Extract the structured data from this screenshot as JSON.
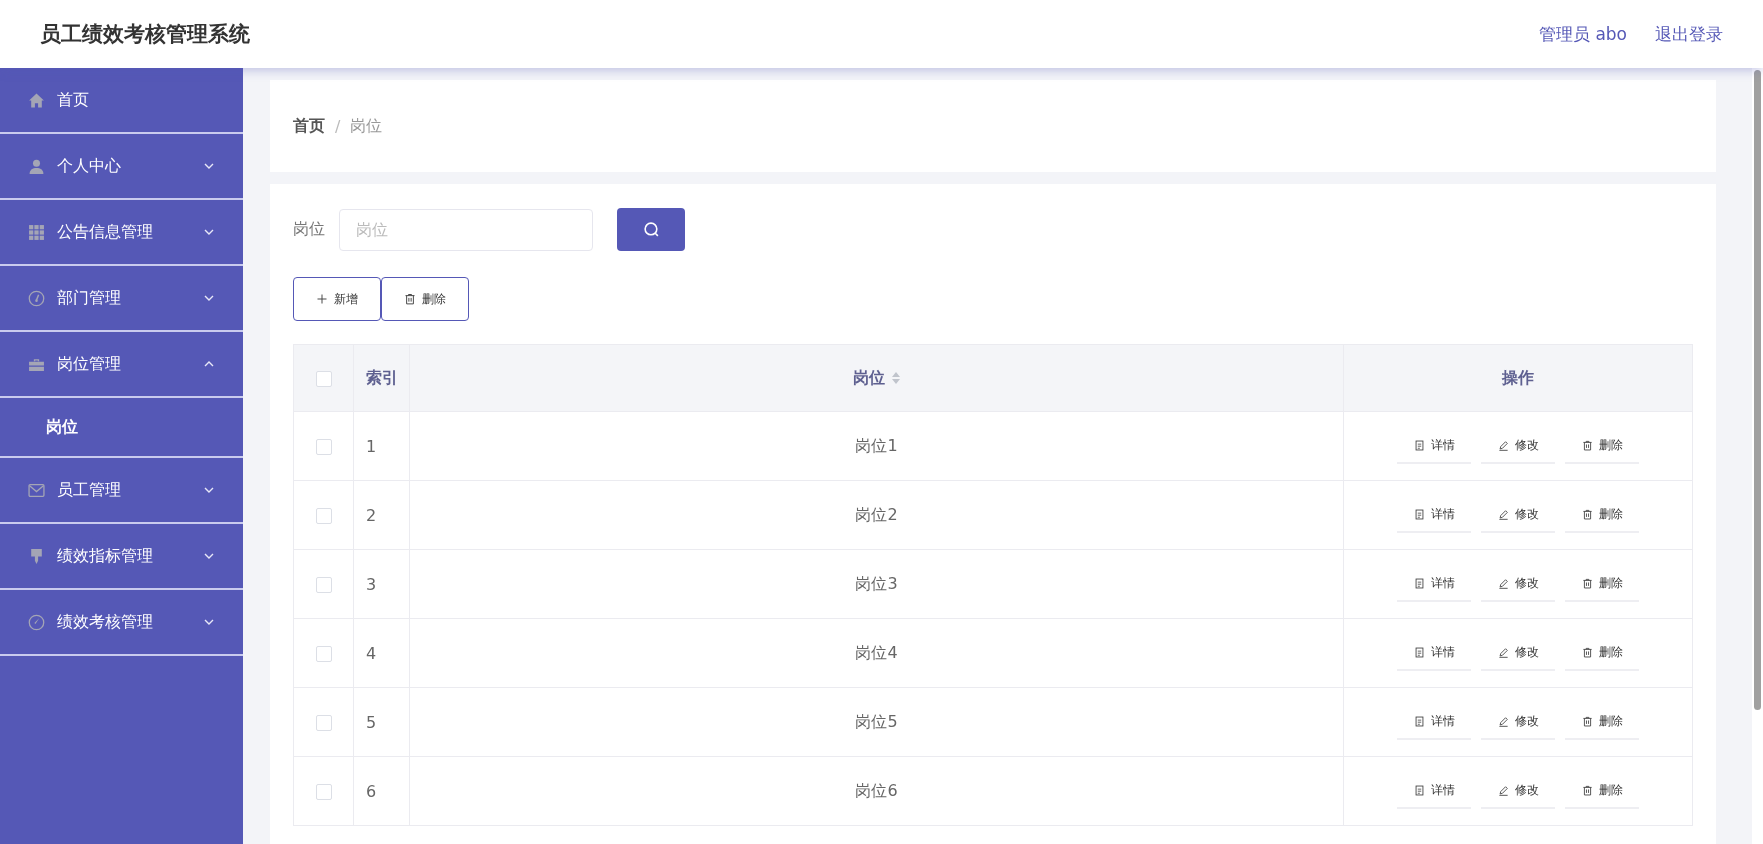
{
  "header": {
    "title": "员工绩效考核管理系统",
    "user": "管理员 abo",
    "logout": "退出登录"
  },
  "sidebar": {
    "items": [
      {
        "label": "首页",
        "kind": "link",
        "selected": false
      },
      {
        "label": "个人中心",
        "kind": "menu",
        "expanded": false
      },
      {
        "label": "公告信息管理",
        "kind": "menu",
        "expanded": false
      },
      {
        "label": "部门管理",
        "kind": "menu",
        "expanded": false
      },
      {
        "label": "岗位管理",
        "kind": "menu",
        "expanded": true,
        "children": [
          {
            "label": "岗位",
            "selected": true
          }
        ]
      },
      {
        "label": "员工管理",
        "kind": "menu",
        "expanded": false
      },
      {
        "label": "绩效指标管理",
        "kind": "menu",
        "expanded": false
      },
      {
        "label": "绩效考核管理",
        "kind": "menu",
        "expanded": false
      }
    ]
  },
  "breadcrumb": {
    "items": [
      "首页",
      "岗位"
    ],
    "separator": "/"
  },
  "search": {
    "label": "岗位",
    "placeholder": "岗位"
  },
  "buttons": [
    {
      "label": "新增",
      "kind": "add"
    },
    {
      "label": "删除",
      "kind": "delete"
    }
  ],
  "table": {
    "select_all": {
      "checked": false
    },
    "columns": [
      {
        "label": "索引",
        "sortable": false
      },
      {
        "label": "岗位",
        "sortable": true
      },
      {
        "label": "操作",
        "sortable": false
      }
    ],
    "rows": [
      {
        "checked": false,
        "index": "1",
        "name": "岗位1",
        "actions": [
          {
            "label": "详情",
            "kind": "details"
          },
          {
            "label": "修改",
            "kind": "edit"
          },
          {
            "label": "删除",
            "kind": "delete"
          }
        ]
      },
      {
        "checked": false,
        "index": "2",
        "name": "岗位2",
        "actions": [
          {
            "label": "详情",
            "kind": "details"
          },
          {
            "label": "修改",
            "kind": "edit"
          },
          {
            "label": "删除",
            "kind": "delete"
          }
        ]
      },
      {
        "checked": false,
        "index": "3",
        "name": "岗位3",
        "actions": [
          {
            "label": "详情",
            "kind": "details"
          },
          {
            "label": "修改",
            "kind": "edit"
          },
          {
            "label": "删除",
            "kind": "delete"
          }
        ]
      },
      {
        "checked": false,
        "index": "4",
        "name": "岗位4",
        "actions": [
          {
            "label": "详情",
            "kind": "details"
          },
          {
            "label": "修改",
            "kind": "edit"
          },
          {
            "label": "删除",
            "kind": "delete"
          }
        ]
      },
      {
        "checked": false,
        "index": "5",
        "name": "岗位5",
        "actions": [
          {
            "label": "详情",
            "kind": "details"
          },
          {
            "label": "修改",
            "kind": "edit"
          },
          {
            "label": "删除",
            "kind": "delete"
          }
        ]
      },
      {
        "checked": false,
        "index": "6",
        "name": "岗位6",
        "actions": [
          {
            "label": "详情",
            "kind": "details"
          },
          {
            "label": "修改",
            "kind": "edit"
          },
          {
            "label": "删除",
            "kind": "delete"
          }
        ]
      }
    ]
  }
}
